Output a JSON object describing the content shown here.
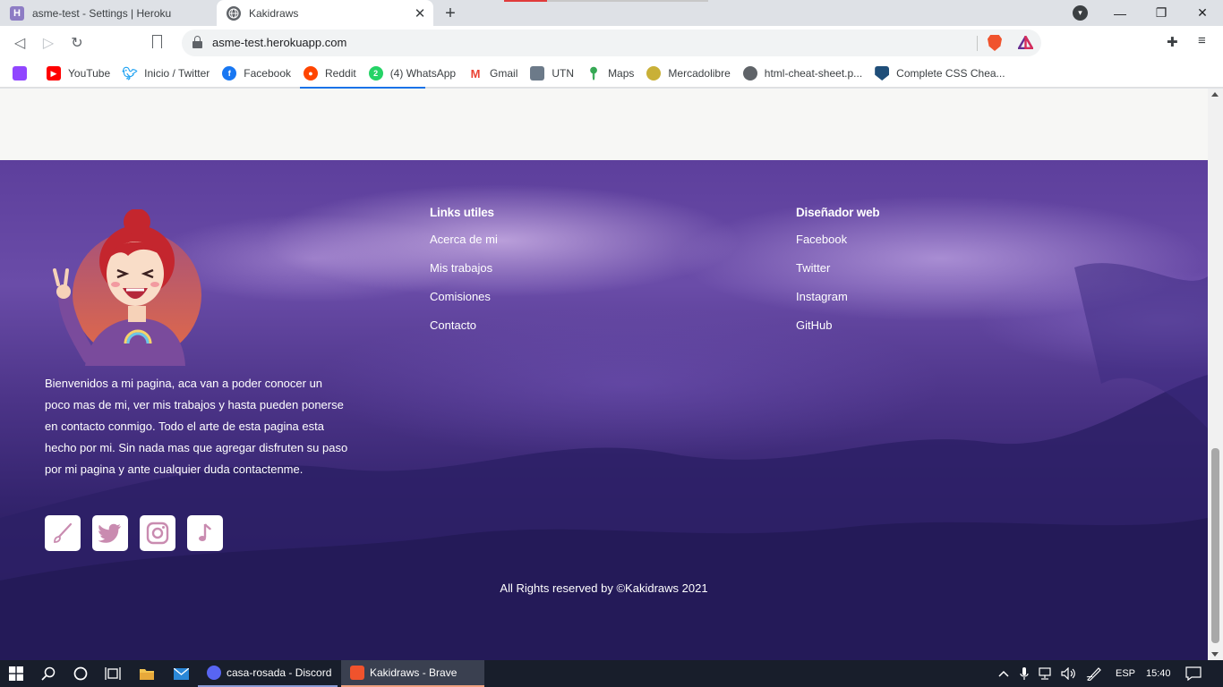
{
  "browser": {
    "tabs": [
      {
        "title": "asme-test - Settings | Heroku",
        "favicon": "heroku-icon",
        "active": false
      },
      {
        "title": "Kakidraws",
        "favicon": "globe-icon",
        "active": true
      }
    ],
    "new_tab_symbol": "+",
    "url": "asme-test.herokuapp.com",
    "window_controls": {
      "minimize": "—",
      "restore": "❐",
      "close": "✕"
    },
    "nav": {
      "back": "◁",
      "forward": "▷",
      "reload": "↻"
    }
  },
  "bookmarks": [
    {
      "label": "",
      "icon": "twitch-icon",
      "color": "#9146ff"
    },
    {
      "label": "YouTube",
      "icon": "youtube-icon",
      "color": "#ff0000"
    },
    {
      "label": "Inicio / Twitter",
      "icon": "twitter-icon",
      "color": "#1da1f2"
    },
    {
      "label": "Facebook",
      "icon": "facebook-icon",
      "color": "#1877f2"
    },
    {
      "label": "Reddit",
      "icon": "reddit-icon",
      "color": "#ff4500"
    },
    {
      "label": "(4) WhatsApp",
      "icon": "whatsapp-icon",
      "color": "#25d366",
      "badge": "2"
    },
    {
      "label": "Gmail",
      "icon": "gmail-icon",
      "color": "#ea4335"
    },
    {
      "label": "UTN",
      "icon": "utn-icon",
      "color": "#6c7a89"
    },
    {
      "label": "Maps",
      "icon": "maps-icon",
      "color": "#34a853"
    },
    {
      "label": "Mercadolibre",
      "icon": "mercadolibre-icon",
      "color": "#c9b037"
    },
    {
      "label": "html-cheat-sheet.p...",
      "icon": "globe-icon",
      "color": "#5f6368"
    },
    {
      "label": "Complete CSS Chea...",
      "icon": "shield-icon",
      "color": "#1f4e79"
    }
  ],
  "footer": {
    "about_text": "Bienvenidos a mi pagina, aca van a poder conocer un poco mas de mi, ver mis trabajos y hasta pueden ponerse en contacto conmigo. Todo el arte de esta pagina esta hecho por mi. Sin nada mas que agregar disfruten su paso por mi pagina y ante cualquier duda contactenme.",
    "social": [
      {
        "icon": "paintbrush-icon"
      },
      {
        "icon": "twitter-icon"
      },
      {
        "icon": "instagram-icon"
      },
      {
        "icon": "music-note-icon"
      }
    ],
    "links_title": "Links utiles",
    "links": [
      "Acerca de mi",
      "Mis trabajos",
      "Comisiones",
      "Contacto"
    ],
    "designer_title": "Diseñador web",
    "designer_links": [
      "Facebook",
      "Twitter",
      "Instagram",
      "GitHub"
    ],
    "copyright": "All Rights reserved by ©Kakidraws 2021"
  },
  "taskbar": {
    "apps": [
      {
        "label": "casa-rosada - Discord",
        "icon": "discord-icon",
        "color": "#5865f2"
      },
      {
        "label": "Kakidraws - Brave",
        "icon": "brave-icon",
        "color": "#f0532d"
      }
    ],
    "language": "ESP",
    "time": "15:40"
  }
}
